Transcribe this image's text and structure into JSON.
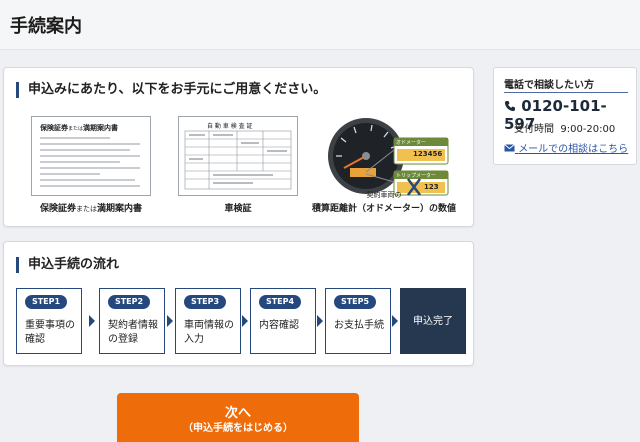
{
  "header": {
    "title": "手続案内"
  },
  "prep": {
    "title": "申込みにあたり、以下をお手元にご用意ください。",
    "items": [
      {
        "caption_a": "保険証券",
        "caption_b": "または",
        "caption_c": "満期案内書",
        "figure_text": "保険証券",
        "figure_sub": "または",
        "figure_text2": "満期案内書"
      },
      {
        "caption": "車検証",
        "figure_text": "自 動 車 検 査 証"
      },
      {
        "caption_top": "契約車両の",
        "caption": "積算距離計（オドメーター）の数値",
        "odo_label": "オドメーター",
        "odo_value": "123456",
        "trip_label": "トリップメーター",
        "trip_value": "123"
      }
    ]
  },
  "flow": {
    "title": "申込手続の流れ",
    "steps": [
      {
        "badge": "STEP1",
        "label_1": "重要事項の",
        "label_2": "確認"
      },
      {
        "badge": "STEP2",
        "label_1": "契約者情報",
        "label_2": "の登録"
      },
      {
        "badge": "STEP3",
        "label_1": "車両情報の",
        "label_2": "入力"
      },
      {
        "badge": "STEP4",
        "label_1": "内容確認",
        "label_2": ""
      },
      {
        "badge": "STEP5",
        "label_1": "お支払手続",
        "label_2": ""
      }
    ],
    "done_label": "申込完了"
  },
  "contact": {
    "title": "電話で相談したい方",
    "phone": "0120-101-597",
    "hours_label": "受付時間",
    "hours_value": "9:00-20:00",
    "mail_link": "メールでの相談はこちら"
  },
  "cta": {
    "main": "次へ",
    "sub": "（申込手続をはじめる）",
    "color": "#ef6c0a"
  }
}
